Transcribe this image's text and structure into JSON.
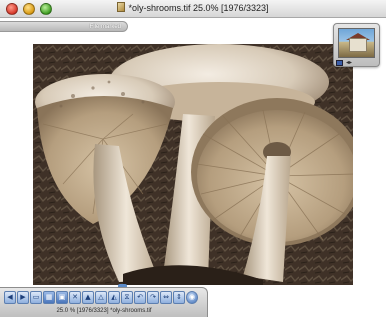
{
  "window": {
    "title": "*oly-shrooms.tif  25.0%  [1976/3323]"
  },
  "marked_bar": {
    "label": "File marked"
  },
  "toolbar": {
    "tools": [
      {
        "name": "previous-icon",
        "glyph": "◀"
      },
      {
        "name": "next-icon",
        "glyph": "▶"
      },
      {
        "name": "fit-window-icon",
        "glyph": "▭"
      },
      {
        "name": "thumbnails-icon",
        "glyph": "▦"
      },
      {
        "name": "mark-file-icon",
        "glyph": "▣"
      },
      {
        "name": "delete-icon",
        "glyph": "✕"
      },
      {
        "name": "zoom-in-icon",
        "glyph": "▲"
      },
      {
        "name": "zoom-out-icon",
        "glyph": "△"
      },
      {
        "name": "actual-size-icon",
        "glyph": "◭"
      },
      {
        "name": "fit-to-screen-icon",
        "glyph": "⧖"
      },
      {
        "name": "rotate-left-icon",
        "glyph": "↶"
      },
      {
        "name": "rotate-right-icon",
        "glyph": "↷"
      },
      {
        "name": "flip-horizontal-icon",
        "glyph": "⇔"
      },
      {
        "name": "flip-vertical-icon",
        "glyph": "⇕"
      },
      {
        "name": "fullscreen-icon",
        "glyph": "◉"
      }
    ],
    "status": "25.0 %  [1976/3323]  *oly-shrooms.tif"
  },
  "colors": {
    "toolbar_accent": "#3f6fb8",
    "photo_background": "#3b2f26"
  }
}
